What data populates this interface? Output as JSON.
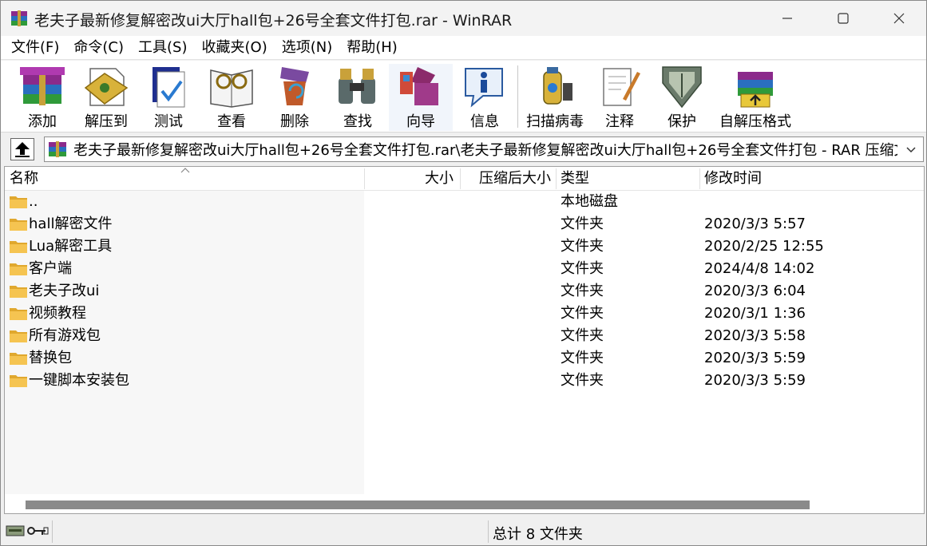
{
  "window": {
    "title": "老夫子最新修复解密改ui大厅hall包+26号全套文件打包.rar - WinRAR",
    "app_icon": "winrar-icon",
    "controls": [
      "minimize-icon",
      "maximize-icon",
      "close-icon"
    ]
  },
  "menu": [
    {
      "label": "文件(F)"
    },
    {
      "label": "命令(C)"
    },
    {
      "label": "工具(S)"
    },
    {
      "label": "收藏夹(O)"
    },
    {
      "label": "选项(N)"
    },
    {
      "label": "帮助(H)"
    }
  ],
  "toolbar": [
    {
      "label": "添加",
      "icon": "add-archive-icon"
    },
    {
      "label": "解压到",
      "icon": "extract-to-icon"
    },
    {
      "label": "测试",
      "icon": "test-icon"
    },
    {
      "label": "查看",
      "icon": "view-icon"
    },
    {
      "label": "删除",
      "icon": "delete-icon"
    },
    {
      "label": "查找",
      "icon": "find-icon"
    },
    {
      "label": "向导",
      "icon": "wizard-icon"
    },
    {
      "label": "信息",
      "icon": "info-icon"
    },
    {
      "label": "扫描病毒",
      "icon": "virus-scan-icon"
    },
    {
      "label": "注释",
      "icon": "comment-icon"
    },
    {
      "label": "保护",
      "icon": "protect-icon"
    },
    {
      "label": "自解压格式",
      "icon": "sfx-icon"
    }
  ],
  "address": {
    "path": "老夫子最新修复解密改ui大厅hall包+26号全套文件打包.rar\\老夫子最新修复解密改ui大厅hall包+26号全套文件打包 - RAR 压缩文件"
  },
  "columns": {
    "name": "名称",
    "size": "大小",
    "packed": "压缩后大小",
    "type": "类型",
    "modified": "修改时间"
  },
  "files": [
    {
      "name": "..",
      "type": "本地磁盘",
      "modified": ""
    },
    {
      "name": "hall解密文件",
      "type": "文件夹",
      "modified": "2020/3/3 5:57"
    },
    {
      "name": "Lua解密工具",
      "type": "文件夹",
      "modified": "2020/2/25 12:55"
    },
    {
      "name": "客户端",
      "type": "文件夹",
      "modified": "2024/4/8 14:02"
    },
    {
      "name": "老夫子改ui",
      "type": "文件夹",
      "modified": "2020/3/3 6:04"
    },
    {
      "name": "视频教程",
      "type": "文件夹",
      "modified": "2020/3/1 1:36"
    },
    {
      "name": "所有游戏包",
      "type": "文件夹",
      "modified": "2020/3/3 5:58"
    },
    {
      "name": "替换包",
      "type": "文件夹",
      "modified": "2020/3/3 5:59"
    },
    {
      "name": "一键脚本安装包",
      "type": "文件夹",
      "modified": "2020/3/3 5:59"
    }
  ],
  "status": {
    "summary": "总计 8 文件夹"
  },
  "colors": {
    "folder": "#f5c451",
    "folder_dark": "#e0a82e",
    "scroll_thumb": "#8a8a8a"
  }
}
